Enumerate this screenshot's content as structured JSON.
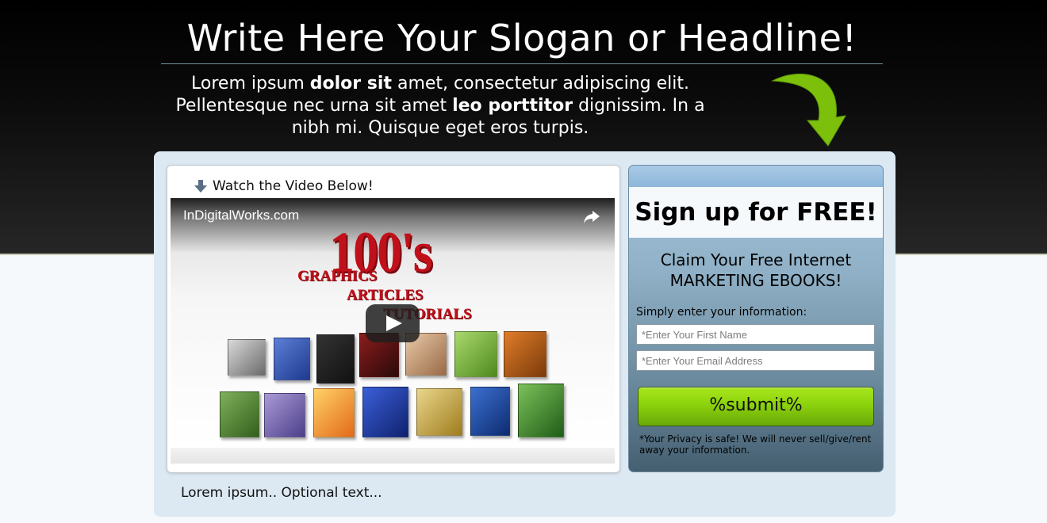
{
  "header": {
    "headline": "Write Here Your Slogan or Headline!",
    "intro": [
      {
        "text": "Lorem ipsum ",
        "bold": false
      },
      {
        "text": "dolor sit",
        "bold": true
      },
      {
        "text": " amet, consectetur adipiscing elit. Pellentesque nec urna sit amet ",
        "bold": false
      },
      {
        "text": "leo porttitor",
        "bold": true
      },
      {
        "text": " dignissim. In a nibh mi. Quisque eget eros turpis.",
        "bold": false
      }
    ],
    "arrow_icon": "curved-arrow-icon",
    "arrow_color": "#7cc00c"
  },
  "video": {
    "heading": "Watch the Video Below!",
    "heading_icon": "down-arrow-icon",
    "channel": "InDigitalWorks.com",
    "share_icon": "share-icon",
    "play_icon": "play-icon",
    "promo_big": "100's",
    "promo_lines": [
      "GRAPHICS",
      "ARTICLES",
      "TUTORIALS"
    ],
    "optional_text": "Lorem ipsum.. Optional text..."
  },
  "signup": {
    "title": "Sign up for FREE!",
    "claim_line1": "Claim Your Free Internet",
    "claim_line2": "MARKETING EBOOKS!",
    "info_label": "Simply enter your information:",
    "first_name_placeholder": "*Enter Your First Name",
    "email_placeholder": "*Enter Your Email Address",
    "submit_label": "%submit%",
    "privacy": "*Your Privacy is safe! We will never sell/give/rent away your information."
  },
  "colors": {
    "submit": "#8cd20d",
    "accent_red": "#c0101a",
    "panel_bg": "#dce8f2"
  }
}
